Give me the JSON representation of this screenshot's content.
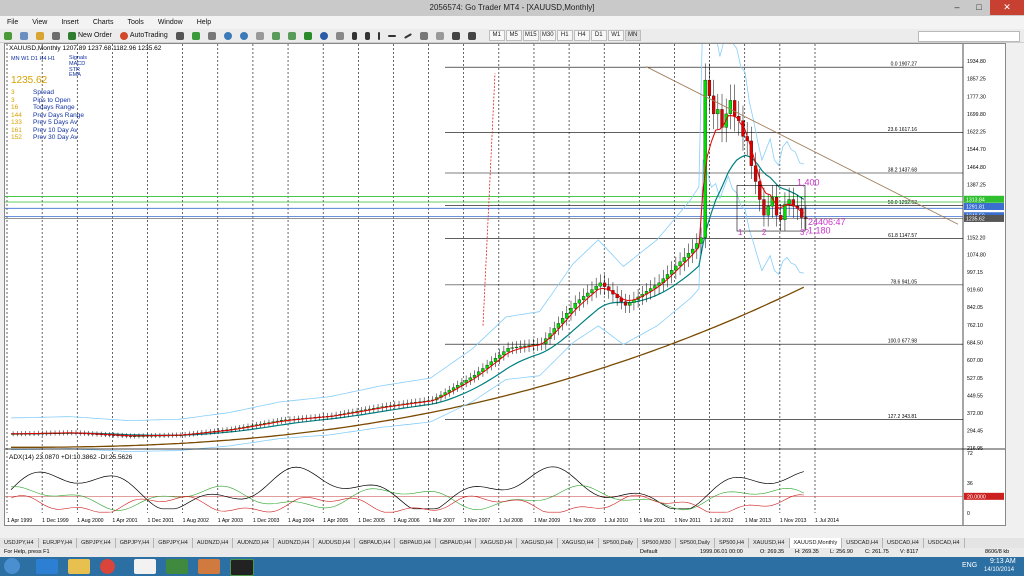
{
  "window": {
    "title": "2056574: Go Trader MT4 - [XAUUSD,Monthly]",
    "minimize": "–",
    "maximize": "□",
    "close": "✕"
  },
  "menu": [
    "File",
    "View",
    "Insert",
    "Charts",
    "Tools",
    "Window",
    "Help"
  ],
  "toolbar": {
    "new_order": "New Order",
    "autotrading": "AutoTrading",
    "timeframes": [
      "M1",
      "M5",
      "M15",
      "M30",
      "H1",
      "H4",
      "D1",
      "W1",
      "MN"
    ]
  },
  "chart": {
    "ohlc_header": "XAUUSD,Monthly 1207.89 1237.68 1182.96 1235.62",
    "timeframe_row": [
      "MN",
      "W1",
      "D1",
      "H4",
      "H1"
    ],
    "legend": [
      "Signals",
      "MACD",
      "STR",
      "EMA"
    ],
    "current_price": "1235.62",
    "stats": [
      {
        "value": "3",
        "label": "Spread"
      },
      {
        "value": "3",
        "label": "Pips to Open"
      },
      {
        "value": "16",
        "label": "Todays Range"
      },
      {
        "value": "144",
        "label": "Prev Days Range"
      },
      {
        "value": "133",
        "label": "Prev 5 Days Av"
      },
      {
        "value": "161",
        "label": "Prev 10 Day Av"
      },
      {
        "value": "152",
        "label": "Prev 30 Day Av"
      }
    ],
    "fib_levels": [
      {
        "label": "0.0  1907.27",
        "price": 1907.27
      },
      {
        "label": "23.6  1617.16",
        "price": 1617.16
      },
      {
        "label": "38.2  1437.68",
        "price": 1437.68
      },
      {
        "label": "50.0  1292.62",
        "price": 1292.62
      },
      {
        "label": "61.8  1147.57",
        "price": 1147.57
      },
      {
        "label": "78.6  941.05",
        "price": 941.05
      },
      {
        "label": "100.0  677.98",
        "price": 677.98
      },
      {
        "label": "127.2  343.81",
        "price": 343.81
      }
    ],
    "price_axis": [
      "1934.80",
      "1857.25",
      "1777.30",
      "1699.80",
      "1622.25",
      "1544.70",
      "1464.80",
      "1387.25",
      "1307.30",
      "1229.75",
      "1152.20",
      "1074.80",
      "997.15",
      "919.60",
      "842.05",
      "762.10",
      "684.50",
      "607.00",
      "527.05",
      "449.55",
      "372.00",
      "294.45",
      "216.95"
    ],
    "price_tags": [
      {
        "text": "1313.84",
        "price": 1321,
        "color": "#2fbf2f"
      },
      {
        "text": "1291.81",
        "price": 1289,
        "color": "#3a6fd0"
      },
      {
        "text": "1248.59",
        "price": 1248,
        "color": "#3a6fd0"
      },
      {
        "text": "1235.62",
        "price": 1236,
        "color": "#555555"
      }
    ],
    "annotations": [
      {
        "text": "1,400",
        "price": 1382,
        "color": "#cc33cc"
      },
      {
        "text": "24406:47",
        "price": 1207,
        "color": "#cc33cc"
      },
      {
        "text": "1,180",
        "price": 1170,
        "color": "#cc33cc"
      },
      {
        "text": "1",
        "price": 1162,
        "color": "#cc33cc"
      },
      {
        "text": "2",
        "price": 1162,
        "color": "#cc33cc"
      },
      {
        "text": "3?",
        "price": 1162,
        "color": "#cc33cc"
      }
    ],
    "date_axis": [
      "1 Apr 1999",
      "1 Dec 1999",
      "1 Aug 2000",
      "1 Apr 2001",
      "1 Dec 2001",
      "1 Aug 2002",
      "1 Apr 2003",
      "1 Dec 2003",
      "1 Aug 2004",
      "1 Apr 2005",
      "1 Dec 2005",
      "1 Aug 2006",
      "1 Mar 2007",
      "1 Nov 2007",
      "1 Jul 2008",
      "1 Mar 2009",
      "1 Nov 2009",
      "1 Jul 2010",
      "1 Mar 2011",
      "1 Nov 2011",
      "1 Jul 2012",
      "1 Mar 2013",
      "1 Nov 2013",
      "1 Jul 2014"
    ],
    "adx_header": "ADX(14) 23.0870 +DI:10.3862 -DI:25.5626",
    "adx_axis": [
      "72",
      "36",
      "20.0000",
      "0"
    ],
    "colors": {
      "bull": "#00dd00",
      "bear": "#dd0000",
      "ema_fast": "#e00000",
      "ema_slow": "#008080",
      "bollinger": "#87cefa",
      "sma_long": "#7a4a00",
      "trend": "#a08060",
      "hline_green": "#2fbf2f",
      "hline_blue": "#3a6fd0"
    }
  },
  "tabs": [
    "USDJPY,H4",
    "EURJPY,H4",
    "GBPJPY,H4",
    "GBPJPY,H4",
    "GBPJPY,H4",
    "AUDNZD,H4",
    "AUDNZD,H4",
    "AUDNZD,H4",
    "AUDUSD,H4",
    "GBPAUD,H4",
    "GBPAUD,H4",
    "GBPAUD,H4",
    "XAGUSD,H4",
    "XAGUSD,H4",
    "XAGUSD,H4",
    "SP500,Daily",
    "SP500,M30",
    "SP500,Daily",
    "SP500,H4",
    "XAUUSD,H4",
    "XAUUSD,Monthly",
    "USDCAD,H4",
    "USDCAD,H4",
    "USDCAD,H4"
  ],
  "active_tab": "XAUUSD,Monthly",
  "status": {
    "help": "For Help, press F1",
    "profile": "Default",
    "datetime": "1999.06.01 00:00",
    "o": "O: 269.35",
    "h": "H: 269.35",
    "l": "L: 256.90",
    "c": "C: 261.75",
    "v": "V: 8117",
    "conn": "8606/8 kb"
  },
  "taskbar": {
    "lang": "ENG",
    "time": "9:13 AM",
    "date": "14/10/2014"
  }
}
